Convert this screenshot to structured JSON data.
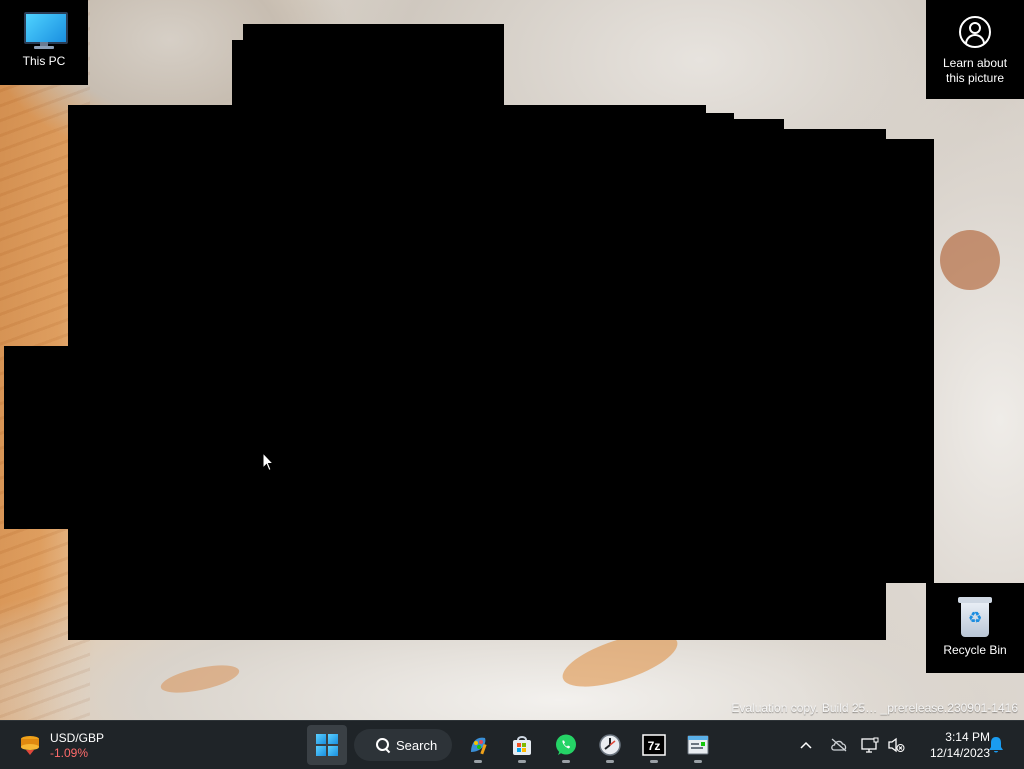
{
  "desktop": {
    "icons": {
      "this_pc": {
        "label": "This PC",
        "icon": "monitor-icon"
      },
      "learn": {
        "label_line1": "Learn about",
        "label_line2": "this picture",
        "icon": "camera-info-icon"
      },
      "recycle_bin": {
        "label": "Recycle Bin",
        "icon": "recycle-bin-icon"
      }
    },
    "watermark": "Evaluation copy. Build 25… _prerelease.230901-1416"
  },
  "taskbar": {
    "widget": {
      "title": "USD/GBP",
      "change": "-1.09%",
      "change_color": "#ff6b6b",
      "icon": "currency-icon"
    },
    "search_label": "Search",
    "pinned": [
      {
        "name": "start",
        "icon": "windows-logo-icon"
      },
      {
        "name": "paint",
        "icon": "paint-icon"
      },
      {
        "name": "microsoft-store",
        "icon": "store-icon"
      },
      {
        "name": "whatsapp",
        "icon": "whatsapp-icon"
      },
      {
        "name": "clock-app",
        "icon": "clock-icon"
      },
      {
        "name": "7-zip",
        "icon": "7zip-icon",
        "text": "7z"
      },
      {
        "name": "notepad",
        "icon": "notepad-icon"
      }
    ],
    "tray": {
      "chevron": "chevron-up-icon",
      "onedrive": "cloud-offline-icon",
      "network": "network-icon",
      "volume": "volume-muted-icon",
      "notifications": "bell-icon"
    },
    "clock": {
      "time": "3:14 PM",
      "date": "12/14/2023"
    }
  },
  "colors": {
    "taskbar_bg": "#1f2428",
    "accent": "#1a8fe0"
  }
}
